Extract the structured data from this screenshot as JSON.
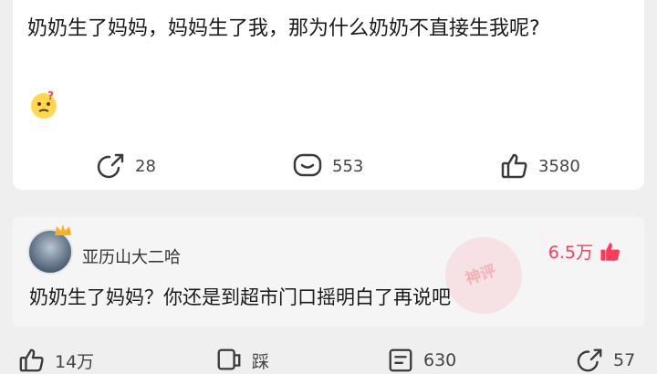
{
  "post": {
    "text": "奶奶生了妈妈，妈妈生了我，那为什么奶奶不直接生我呢?",
    "emoji": "thinking-face",
    "actions": {
      "share_count": "28",
      "comment_count": "553",
      "like_count": "3580"
    }
  },
  "comment": {
    "username": "亚历山大二哈",
    "like_count": "6.5万",
    "text": "奶奶生了妈妈？你还是到超市门口摇明白了再说吧",
    "stamp_label": "神评"
  },
  "bottom_bar": {
    "like_count": "14万",
    "dislike_label": "踩",
    "comment_count": "630",
    "share_count": "57"
  },
  "colors": {
    "accent": "#ff3b5c",
    "icon": "#3a3a3a"
  }
}
